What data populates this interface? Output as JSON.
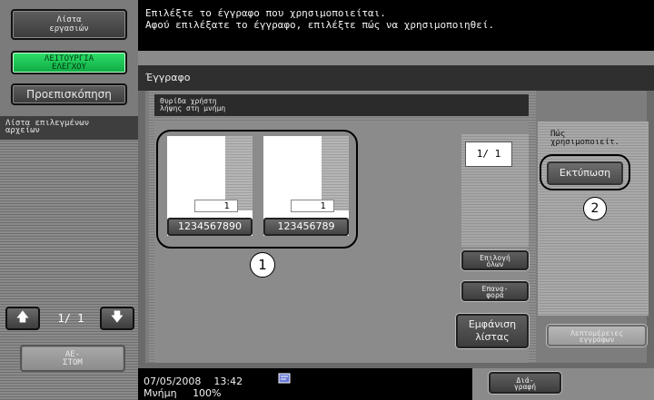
{
  "sidebar": {
    "jobs_label": "Λίστα\nεργασιών",
    "functions_label": "ΛΕΙΤΟΥΡΓΙΑ\nΕΛΕΓΧΟΥ",
    "preview_label": "Προεπισκόπηση",
    "selected_files_label": "Λίστα επιλεγμένων\nαρχείων",
    "pager": "1/  1",
    "delete_label": "ΑΕ-\nΣΤΟΜ"
  },
  "message": {
    "line1": "Επιλέξτε το έγγραφο που χρησιμοποιείται.",
    "line2": "Αφού επιλέξατε το έγγραφο, επιλέξτε πώς να χρησιμοποιηθεί."
  },
  "tab": {
    "title": "Έγγραφο"
  },
  "box": {
    "header": "Θυρίδα χρήστη\nλήψης στη μνήμη"
  },
  "documents": [
    {
      "name": "1234567890",
      "count": "1"
    },
    {
      "name": "123456789",
      "count": "1"
    }
  ],
  "page_count": "1/  1",
  "buttons": {
    "select_all": "Επιλογή\nόλων",
    "reset": "Επανα-\nφορά",
    "list_view": "Εμφάνιση\nλίστας",
    "print": "Εκτύπωση",
    "doc_details": "Λεπτομέρειες\nεγγράφων",
    "close": "Διά-\nγραφή"
  },
  "use_label": "Πώς\nχρησιμοποιείτ.",
  "callouts": {
    "one": "1",
    "two": "2"
  },
  "status": {
    "date": "07/05/2008",
    "time": "13:42",
    "memory_label": "Μνήμη",
    "memory_value": "100%"
  }
}
